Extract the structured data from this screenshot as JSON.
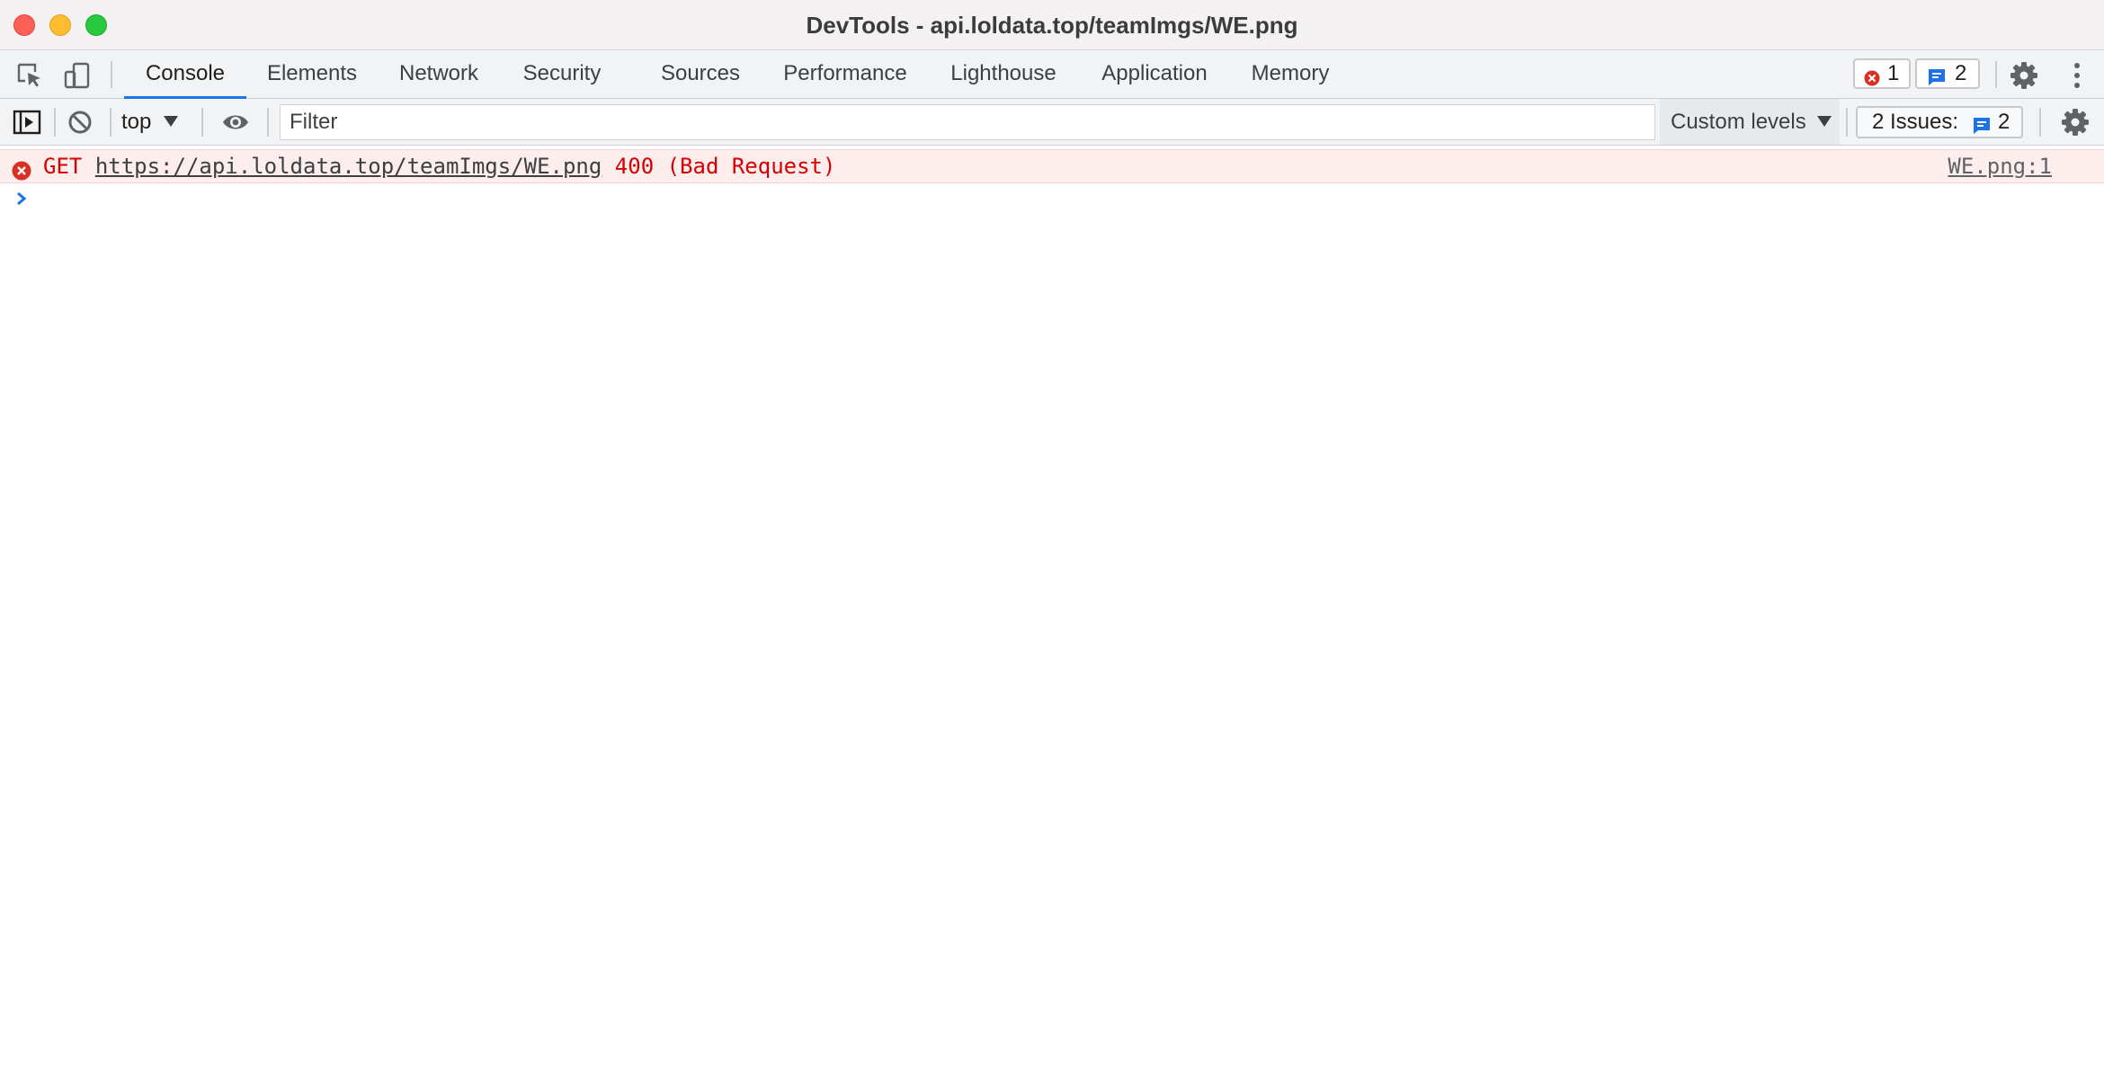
{
  "window": {
    "title": "DevTools - api.loldata.top/teamImgs/WE.png"
  },
  "tabbar": {
    "icons": [
      "inspect-element-icon",
      "device-toolbar-icon"
    ],
    "tabs": [
      {
        "label": "Console",
        "active": true
      },
      {
        "label": "Elements",
        "active": false
      },
      {
        "label": "Network",
        "active": false
      },
      {
        "label": "Security",
        "active": false
      },
      {
        "label": "Sources",
        "active": false
      },
      {
        "label": "Performance",
        "active": false
      },
      {
        "label": "Lighthouse",
        "active": false
      },
      {
        "label": "Application",
        "active": false
      },
      {
        "label": "Memory",
        "active": false
      }
    ],
    "error_count": "1",
    "message_count": "2",
    "actions": [
      "settings-icon",
      "more-menu-icon"
    ]
  },
  "console_toolbar": {
    "context": "top",
    "filter_placeholder": "Filter",
    "filter_value": "",
    "levels": "Custom levels",
    "issues_label": "2 Issues:",
    "issues_count": "2"
  },
  "console": {
    "messages": [
      {
        "level": "error",
        "method": "GET",
        "url": "https://api.loldata.top/teamImgs/WE.png",
        "status": "400 (Bad Request)",
        "source": "WE.png:1"
      }
    ]
  },
  "colors": {
    "accent": "#1a73e8",
    "error": "#d60000",
    "error_bg": "#fdeded",
    "toolbar_bg": "#f1f3f4"
  }
}
